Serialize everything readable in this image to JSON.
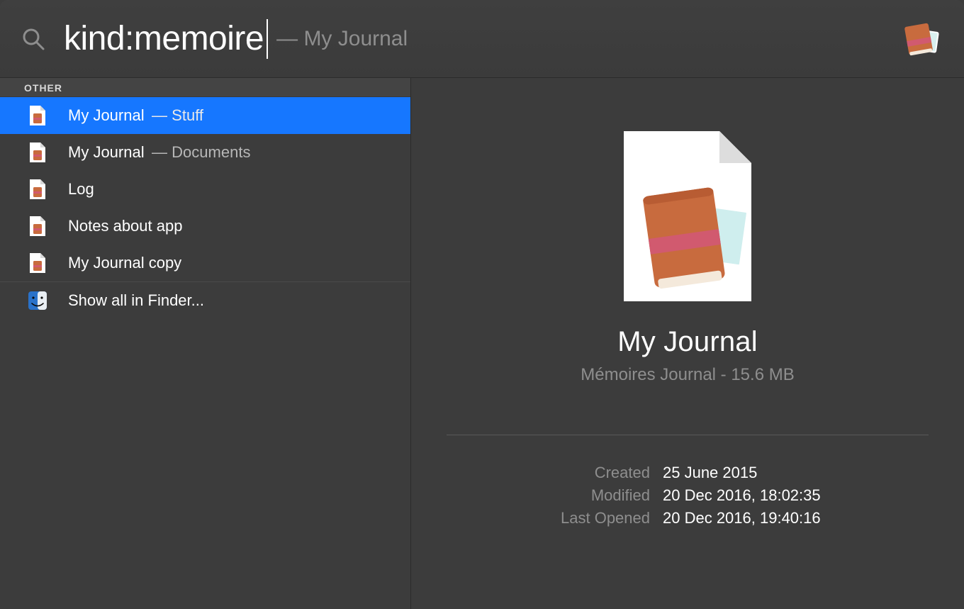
{
  "search": {
    "query": "kind:memoire",
    "hint_prefix": "— ",
    "hint": "My Journal"
  },
  "results": {
    "section": "OTHER",
    "items": [
      {
        "label": "My Journal",
        "sub": "Stuff",
        "icon": "memoires-doc",
        "selected": true
      },
      {
        "label": "My Journal",
        "sub": "Documents",
        "icon": "memoires-doc",
        "selected": false
      },
      {
        "label": "Log",
        "sub": "",
        "icon": "memoires-doc",
        "selected": false
      },
      {
        "label": "Notes about app",
        "sub": "",
        "icon": "memoires-doc",
        "selected": false
      },
      {
        "label": "My Journal copy",
        "sub": "",
        "icon": "memoires-doc",
        "selected": false
      }
    ],
    "show_all": "Show all in Finder..."
  },
  "preview": {
    "title": "My Journal",
    "kind": "Mémoires Journal",
    "size": "15.6 MB",
    "meta": {
      "created_label": "Created",
      "created": "25 June 2015",
      "modified_label": "Modified",
      "modified": "20 Dec 2016, 18:02:35",
      "opened_label": "Last Opened",
      "opened": "20 Dec 2016, 19:40:16"
    }
  },
  "icons": {
    "app": "memoires-app",
    "finder": "finder"
  },
  "colors": {
    "bg": "#3c3c3c",
    "selection": "#1677ff",
    "muted": "#8e8e8e",
    "book_orange": "#c86b3e",
    "book_band": "#d15a6f"
  }
}
